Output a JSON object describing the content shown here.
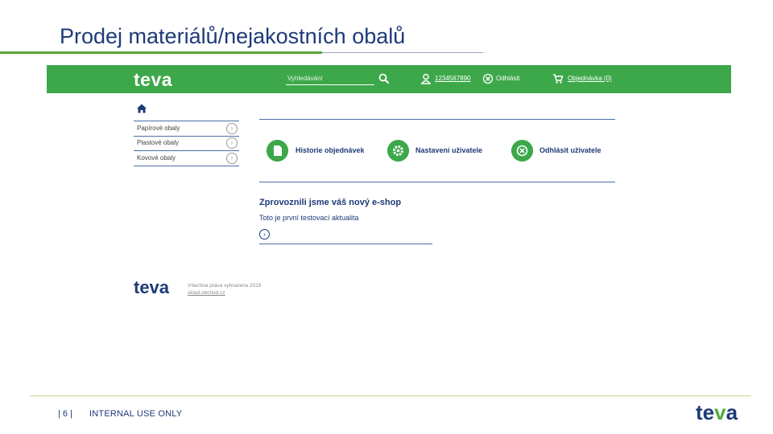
{
  "slide": {
    "title": "Prodej materiálů/nejakostních obalů"
  },
  "header": {
    "logo": "teva",
    "search_placeholder": "Vyhledávání",
    "user_id": "1234567890",
    "logout": "Odhlásit",
    "cart": "Objednávka (0)"
  },
  "sidebar": {
    "items": [
      {
        "label": "Papírové obaly"
      },
      {
        "label": "Plastové obaly"
      },
      {
        "label": "Kovové obaly"
      }
    ]
  },
  "tiles": [
    {
      "label": "Historie objednávek",
      "icon": "document-icon"
    },
    {
      "label": "Nastavení uživatele",
      "icon": "gear-icon"
    },
    {
      "label": "Odhlásit uživatele",
      "icon": "close-icon"
    }
  ],
  "news": {
    "title": "Zprovoznili jsme váš nový e-shop",
    "subtitle": "Toto je první testovací aktualita"
  },
  "site_footer": {
    "logo": "teva",
    "copyright": "Všechna práva vyhrazena 2019",
    "link": "sklad.obchod.cz"
  },
  "page_footer": {
    "page_number": "| 6 |",
    "classification": "INTERNAL USE ONLY",
    "logo_left": "te",
    "logo_v": "v",
    "logo_right": "a"
  },
  "colors": {
    "brand_green": "#3da84a",
    "brand_navy": "#1e3a78"
  }
}
